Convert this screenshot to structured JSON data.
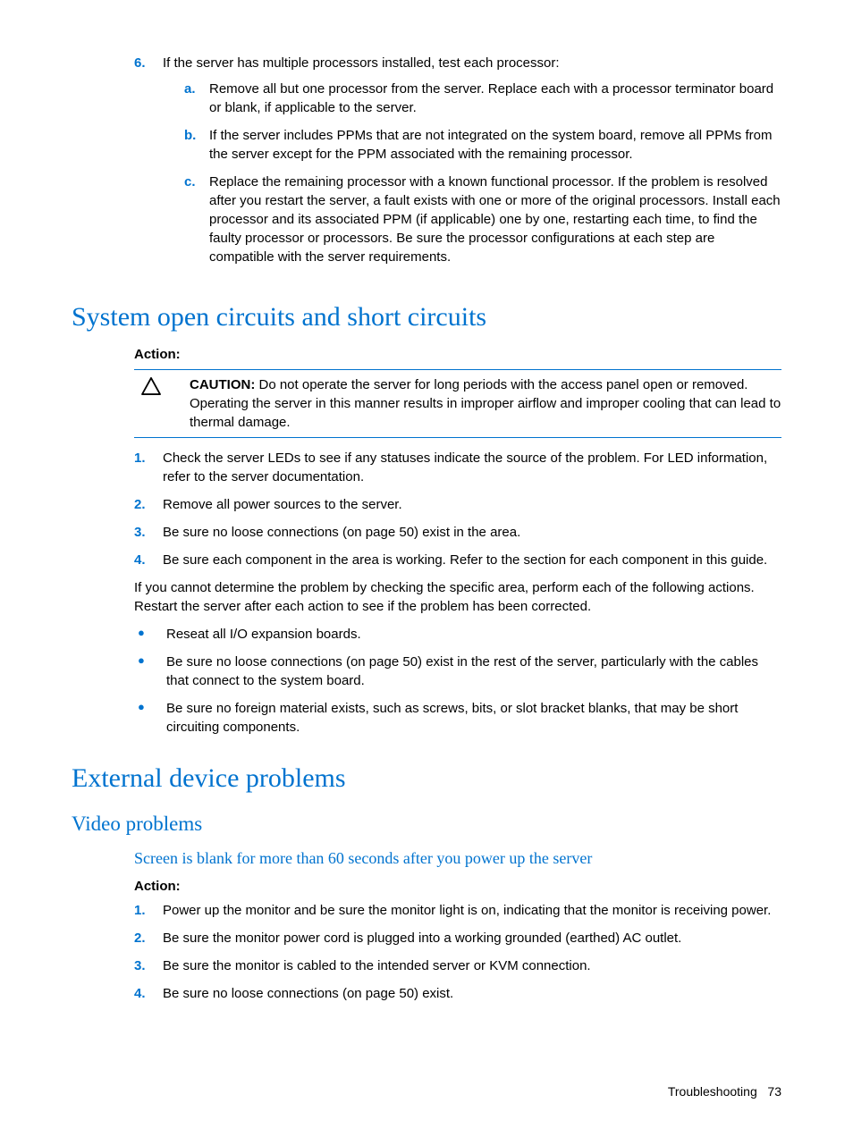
{
  "step6": {
    "marker": "6.",
    "intro": "If the server has multiple processors installed, test each processor:",
    "sub": [
      {
        "marker": "a.",
        "text": "Remove all but one processor from the server. Replace each with a processor terminator board or blank, if applicable to the server."
      },
      {
        "marker": "b.",
        "text": "If the server includes PPMs that are not integrated on the system board, remove all PPMs from the server except for the PPM associated with the remaining processor."
      },
      {
        "marker": "c.",
        "text": "Replace the remaining processor with a known functional processor. If the problem is resolved after you restart the server, a fault exists with one or more of the original processors. Install each processor and its associated PPM (if applicable) one by one, restarting each time, to find the faulty processor or processors. Be sure the processor configurations at each step are compatible with the server requirements."
      }
    ]
  },
  "section1": {
    "heading": "System open circuits and short circuits",
    "action": "Action:",
    "caution_label": "CAUTION:",
    "caution_text": "  Do not operate the server for long periods with the access panel open or removed. Operating the server in this manner results in improper airflow and improper cooling that can lead to thermal damage.",
    "steps": [
      {
        "marker": "1.",
        "text": "Check the server LEDs to see if any statuses indicate the source of the problem. For LED information, refer to the server documentation."
      },
      {
        "marker": "2.",
        "text": "Remove all power sources to the server."
      },
      {
        "marker": "3.",
        "text": "Be sure no loose connections (on page 50) exist in the area."
      },
      {
        "marker": "4.",
        "text": "Be sure each component in the area is working. Refer to the section for each component in this guide."
      }
    ],
    "para": "If you cannot determine the problem by checking the specific area, perform each of the following actions. Restart the server after each action to see if the problem has been corrected.",
    "bullets": [
      "Reseat all I/O expansion boards.",
      "Be sure no loose connections (on page 50) exist in the rest of the server, particularly with the cables that connect to the system board.",
      "Be sure no foreign material exists, such as screws, bits, or slot bracket blanks, that may be short circuiting components."
    ]
  },
  "section2": {
    "heading": "External device problems",
    "sub_heading": "Video problems",
    "sub_sub_heading": "Screen is blank for more than 60 seconds after you power up the server",
    "action": "Action:",
    "steps": [
      {
        "marker": "1.",
        "text": "Power up the monitor and be sure the monitor light is on, indicating that the monitor is receiving power."
      },
      {
        "marker": "2.",
        "text": "Be sure the monitor power cord is plugged into a working grounded (earthed) AC outlet."
      },
      {
        "marker": "3.",
        "text": "Be sure the monitor is cabled to the intended server or KVM connection."
      },
      {
        "marker": "4.",
        "text": "Be sure no loose connections (on page 50) exist."
      }
    ]
  },
  "footer": {
    "section": "Troubleshooting",
    "page": "73"
  }
}
